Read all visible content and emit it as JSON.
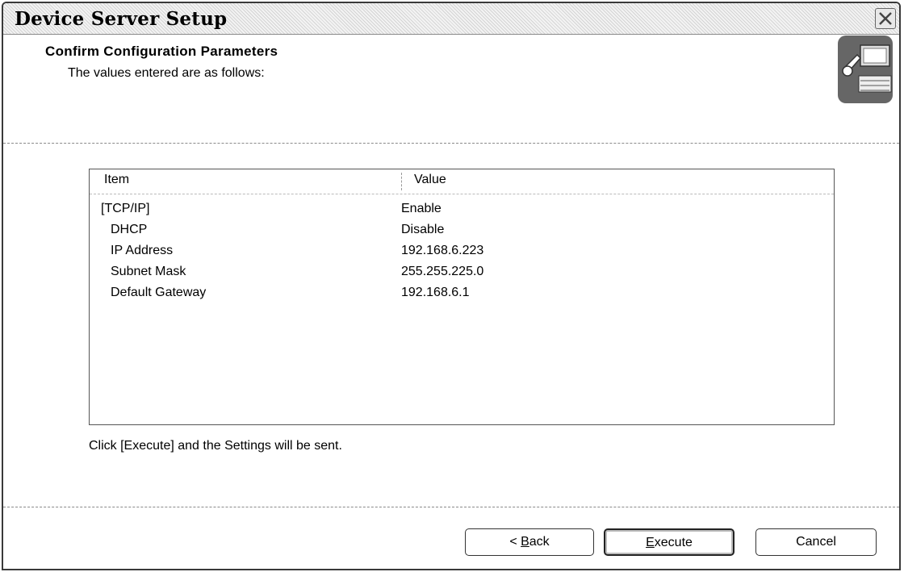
{
  "window": {
    "title": "Device Server Setup"
  },
  "header": {
    "title": "Confirm Configuration Parameters",
    "subtitle": "The values entered are as follows:",
    "icon": "device-setup-icon"
  },
  "table": {
    "columns": [
      "Item",
      "Value"
    ],
    "rows": [
      {
        "item": "[TCP/IP]",
        "value": "Enable",
        "indent": false
      },
      {
        "item": "DHCP",
        "value": "Disable",
        "indent": true
      },
      {
        "item": "IP Address",
        "value": "192.168.6.223",
        "indent": true
      },
      {
        "item": "Subnet Mask",
        "value": "255.255.225.0",
        "indent": true
      },
      {
        "item": "Default Gateway",
        "value": "192.168.6.1",
        "indent": true
      }
    ]
  },
  "footer": {
    "instruction": "Click [Execute] and the Settings will be sent."
  },
  "buttons": {
    "back": {
      "prefix": "< ",
      "mnemonic": "B",
      "rest": "ack"
    },
    "execute": {
      "mnemonic": "E",
      "rest": "xecute"
    },
    "cancel": {
      "label": "Cancel"
    }
  }
}
